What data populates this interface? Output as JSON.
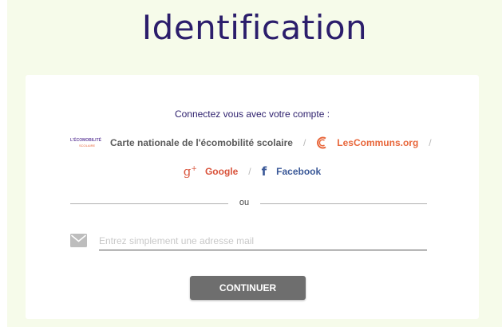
{
  "page": {
    "title": "Identification"
  },
  "login": {
    "connect_text": "Connectez vous avec votre compte :",
    "providers": [
      {
        "name": "Carte nationale de l'écomobilité scolaire",
        "logo_text_top": "L'ÉCOMOBILITÉ",
        "logo_text_bottom": "SCOLAIRE"
      },
      {
        "name": "LesCommuns.org"
      },
      {
        "name": "Google"
      },
      {
        "name": "Facebook"
      }
    ],
    "separator": "/",
    "divider_text": "ou",
    "email_placeholder": "Entrez simplement une adresse mail",
    "email_value": "",
    "continue_label": "CONTINUER"
  },
  "icons": {
    "google": "google-plus-icon",
    "facebook": "facebook-icon",
    "lescommuns": "lescommuns-logo-icon",
    "mail": "mail-icon"
  },
  "colors": {
    "background": "#f6fbea",
    "title": "#2b1d6b",
    "google": "#d9533b",
    "facebook": "#3b5998",
    "lescommuns": "#e8663a",
    "button": "#6e6e6e"
  }
}
